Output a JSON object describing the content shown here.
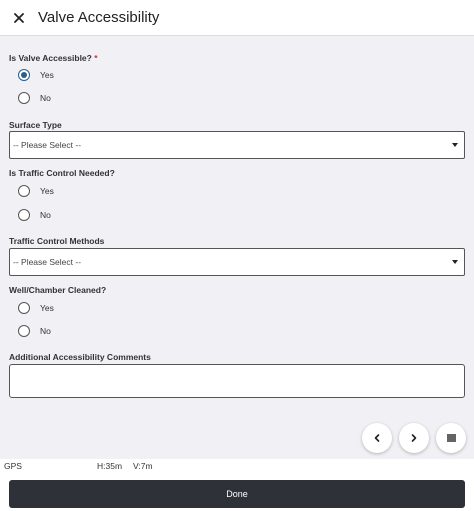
{
  "header": {
    "title": "Valve Accessibility"
  },
  "form": {
    "valve_accessible": {
      "label": "Is Valve Accessible?",
      "required_mark": "*",
      "options": [
        {
          "label": "Yes",
          "checked": true
        },
        {
          "label": "No",
          "checked": false
        }
      ]
    },
    "surface_type": {
      "label": "Surface Type",
      "selected": "-- Please Select --"
    },
    "traffic_control_needed": {
      "label": "Is Traffic Control Needed?",
      "options": [
        {
          "label": "Yes",
          "checked": false
        },
        {
          "label": "No",
          "checked": false
        }
      ]
    },
    "traffic_control_methods": {
      "label": "Traffic Control Methods",
      "selected": "-- Please Select --"
    },
    "well_chamber_cleaned": {
      "label": "Well/Chamber Cleaned?",
      "options": [
        {
          "label": "Yes",
          "checked": false
        },
        {
          "label": "No",
          "checked": false
        }
      ]
    },
    "comments": {
      "label": "Additional Accessibility Comments",
      "value": ""
    }
  },
  "nav": {
    "prev_icon": "chevron-left-icon",
    "next_icon": "chevron-right-icon",
    "menu_icon": "list-icon"
  },
  "gps": {
    "label": "GPS",
    "horizontal": "H:35m",
    "vertical": "V:7m"
  },
  "footer": {
    "done_label": "Done"
  },
  "colors": {
    "accent": "#2a5e8c",
    "required": "#d0312d",
    "done_button": "#2e3238",
    "background": "#f0f0f5"
  }
}
